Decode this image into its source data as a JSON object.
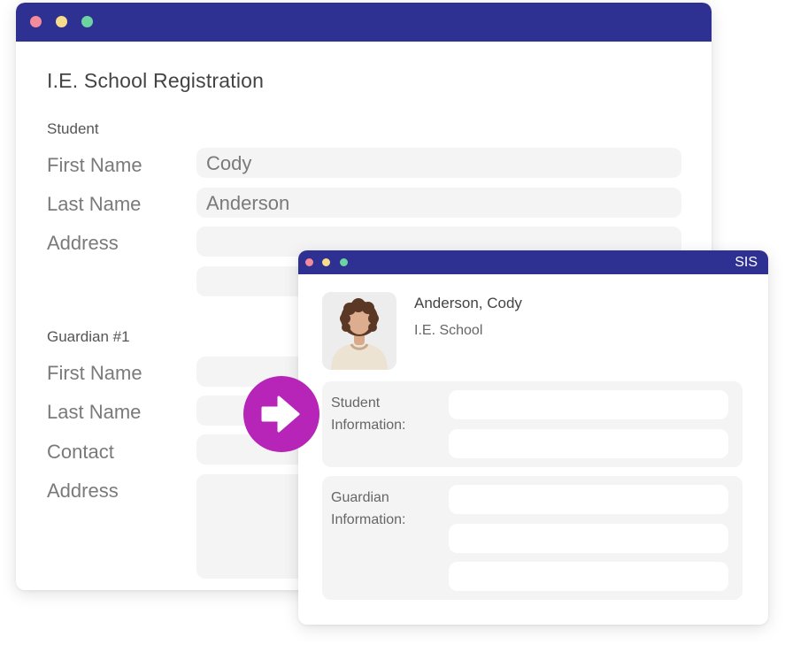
{
  "colors": {
    "titlebar": "#2e3191",
    "accent": "#b624b8",
    "dot_red": "#f28b9b",
    "dot_yellow": "#f6dc8c",
    "dot_green": "#6ed3a2",
    "field_bg": "#f4f4f4"
  },
  "registration": {
    "title": "I.E. School Registration",
    "student_section": "Student",
    "student_fields": {
      "first_name_label": "First Name",
      "first_name_value": "Cody",
      "last_name_label": "Last Name",
      "last_name_value": "Anderson",
      "address_label": "Address"
    },
    "guardian_section": "Guardian #1",
    "guardian_fields": {
      "first_name_label": "First Name",
      "last_name_label": "Last Name",
      "contact_label": "Contact",
      "address_label": "Address"
    }
  },
  "sis": {
    "title": "SIS",
    "profile_name": "Anderson, Cody",
    "profile_school": "I.E. School",
    "student_info_line1": "Student",
    "student_info_line2": "Information:",
    "guardian_info_line1": "Guardian",
    "guardian_info_line2": "Information:"
  },
  "icons": {
    "transfer": "arrow-right-icon",
    "avatar": "student-avatar"
  }
}
